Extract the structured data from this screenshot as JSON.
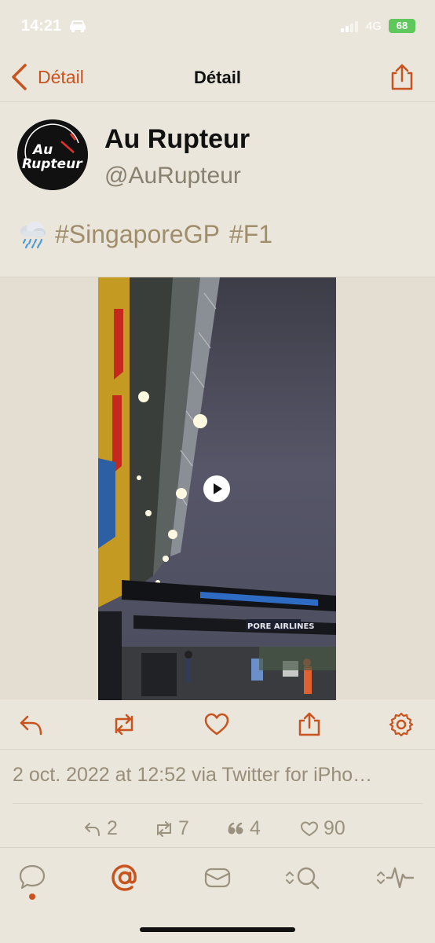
{
  "status": {
    "time": "14:21",
    "network": "4G",
    "battery": "68"
  },
  "nav": {
    "back_label": "Détail",
    "title": "Détail"
  },
  "author": {
    "name": "Au Rupteur",
    "handle": "@AuRupteur",
    "avatar_text_line1": "Au",
    "avatar_text_line2": "Rupteur"
  },
  "tweet": {
    "emoji_icon": "cloud-rain-icon",
    "hashtags": [
      "#SingaporeGP",
      "#F1"
    ]
  },
  "media": {
    "type": "video",
    "signage_text": "PORE AIRLINES"
  },
  "meta": {
    "timestamp": "2 oct. 2022 at 12:52 via Twitter for iPho…"
  },
  "counts": {
    "replies": "2",
    "retweets": "7",
    "quotes": "4",
    "likes": "90"
  },
  "tabs": [
    "chat-bubble-icon",
    "at-sign-icon",
    "envelope-icon",
    "search-icon",
    "activity-icon"
  ],
  "colors": {
    "accent": "#c9531e",
    "background": "#ebe6dc",
    "hashtag": "#a08e6b",
    "muted": "#988e7a"
  }
}
